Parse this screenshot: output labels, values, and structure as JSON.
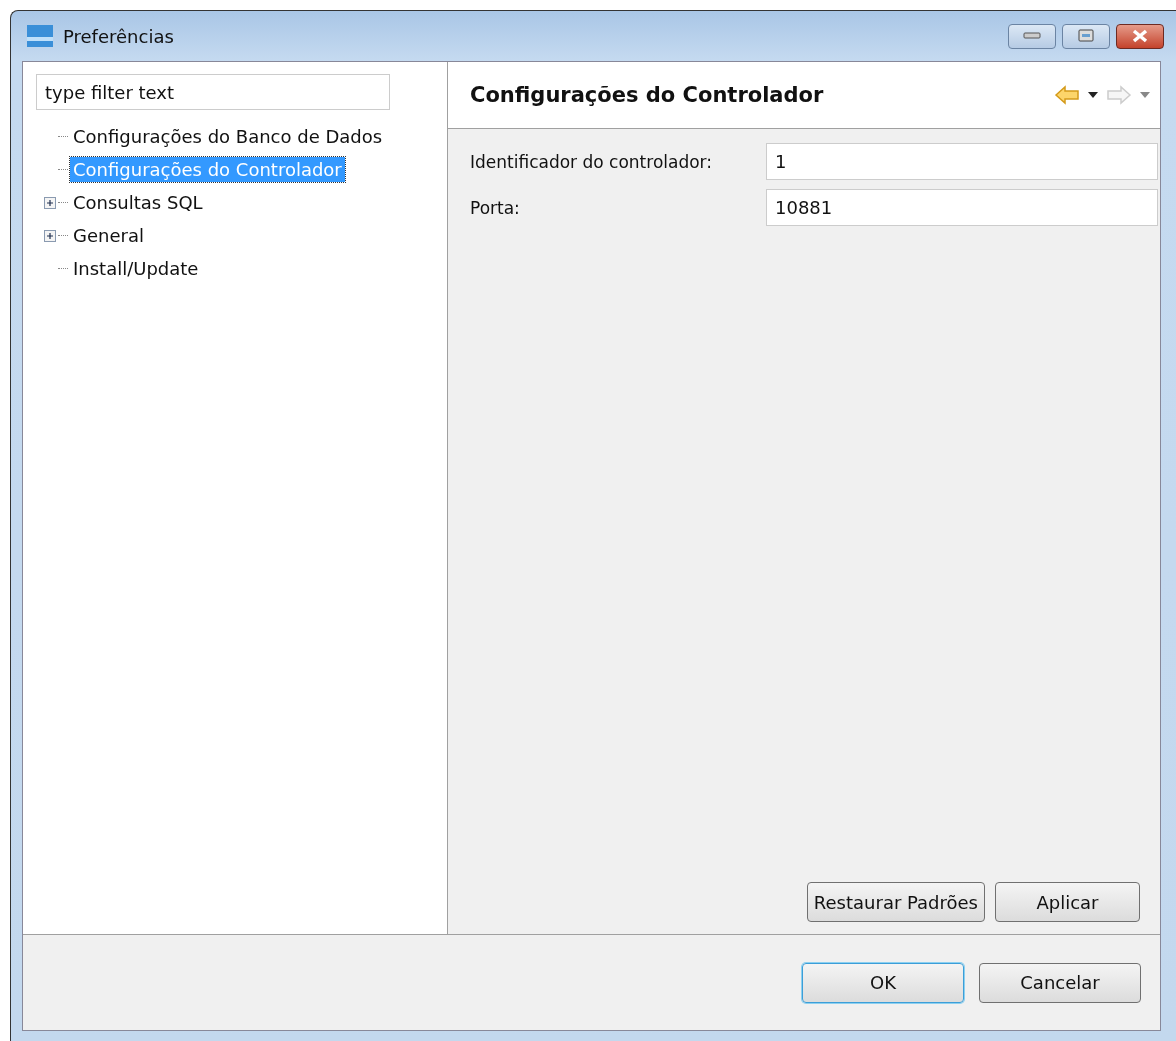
{
  "window": {
    "title": "Preferências"
  },
  "filter": {
    "placeholder": "type filter text"
  },
  "tree": [
    {
      "label": "Configurações do Banco de Dados",
      "selected": false,
      "collapsed": false
    },
    {
      "label": "Configurações do Controlador",
      "selected": true,
      "collapsed": false
    },
    {
      "label": "Consultas SQL",
      "selected": false,
      "collapsed": true
    },
    {
      "label": "General",
      "selected": false,
      "collapsed": true
    },
    {
      "label": "Install/Update",
      "selected": false,
      "collapsed": false
    }
  ],
  "page": {
    "title": "Configurações do Controlador",
    "back_enabled": true,
    "forward_enabled": false
  },
  "fields": [
    {
      "label": "Identificador do controlador:",
      "value": "1"
    },
    {
      "label": "Porta:",
      "value": "10881"
    }
  ],
  "page_buttons": [
    "Restaurar Padrões",
    "Aplicar"
  ],
  "dialog_buttons": [
    {
      "label": "OK",
      "default": true
    },
    {
      "label": "Cancelar",
      "default": false
    }
  ]
}
